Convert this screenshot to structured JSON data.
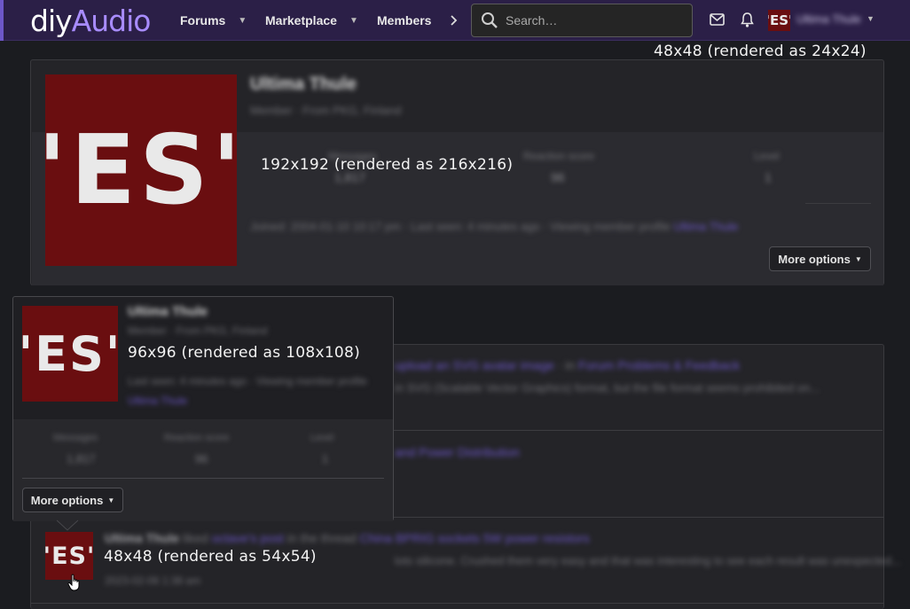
{
  "header": {
    "logo_diy": "diy",
    "logo_audio": "Audio",
    "nav": [
      {
        "label": "Forums"
      },
      {
        "label": "Marketplace"
      },
      {
        "label": "Members"
      }
    ],
    "search_placeholder": "Search…",
    "account_name": "Ultima Thule"
  },
  "avatar_text": "'ES'",
  "annotations": {
    "top_right": "48x48 (rendered as 24x24)",
    "large": "192x192 (rendered as 216x216)",
    "medium": "96x96 (rendered as 108x108)",
    "small": "48x48 (rendered as 54x54)"
  },
  "profile_card": {
    "name": "Ultima Thule",
    "subtitle": "Member · From PKG, Finland",
    "stats": [
      {
        "label": "Messages",
        "value": "1,817"
      },
      {
        "label": "Reaction score",
        "value": "96"
      },
      {
        "label": "Level",
        "value": "1"
      }
    ],
    "meta": "Joined: 2004-01-10 10:17 pm · Last seen: 4 minutes ago · Viewing member profile",
    "meta_link": "Ultima Thule",
    "more_options": "More options"
  },
  "popup": {
    "name": "Ultima Thule",
    "subtitle": "Member · From PKG, Finland",
    "last_seen": "Last seen: 4 minutes ago · Viewing member profile",
    "last_seen_link": "Ultima Thule",
    "stats": [
      {
        "label": "Messages",
        "value": "1,817"
      },
      {
        "label": "Reaction score",
        "value": "96"
      },
      {
        "label": "Level",
        "value": "1"
      }
    ],
    "more_options": "More options"
  },
  "activity": [
    {
      "line1_link": "upload an SVG avatar image",
      "line1_mid": "· in",
      "line1_link2": "Forum Problems & Feedback",
      "line2": "in SVG (Scalable Vector Graphics) format, but the file format seems prohibited on..."
    },
    {
      "line1_link": "and Power Distribution"
    },
    {
      "name": "Ultima Thule",
      "action": "liked",
      "link1": "octave's post",
      "mid": "in the thread",
      "link2": "China BPRIG sockets 5W power resistors",
      "line2": "lots silicone. Crushed them very easy and that was interesting to see each result was unexpected...",
      "time": "2023-02-06 1:38 am"
    }
  ]
}
